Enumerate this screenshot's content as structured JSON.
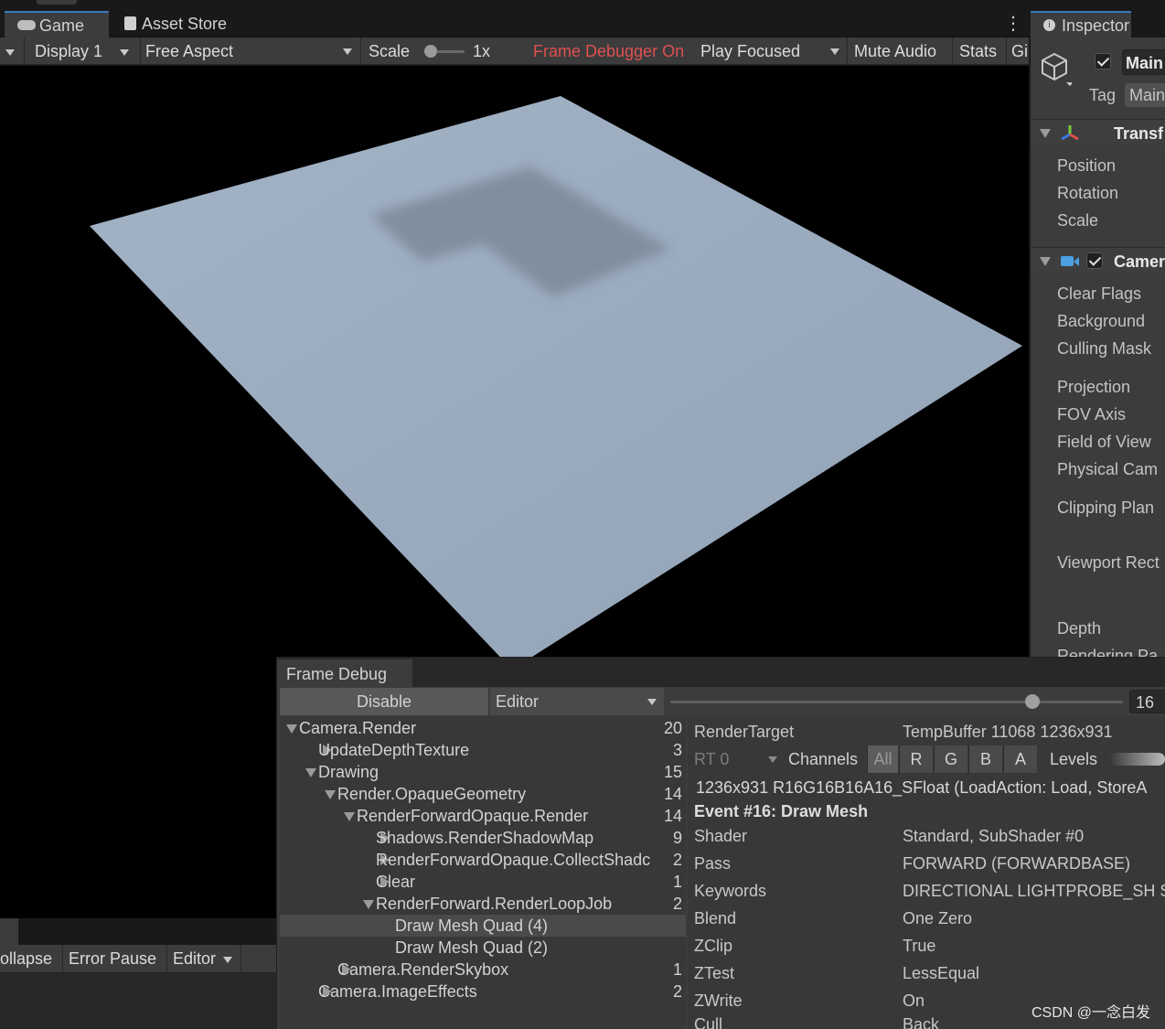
{
  "tabs": {
    "game": "Game",
    "asset_store": "Asset Store",
    "inspector": "Inspector"
  },
  "toolbar": {
    "display": "Display 1",
    "aspect": "Free Aspect",
    "scale_label": "Scale",
    "scale_value": "1x",
    "frame_debugger": "Frame Debugger On",
    "play_focused": "Play Focused",
    "mute_audio": "Mute Audio",
    "stats": "Stats",
    "gizmos": "Gi"
  },
  "colors": {
    "frame_debugger_on": "#e05050",
    "plane": "#9aabbf",
    "shadow": "#7e8b9b",
    "accent_tab": "#3a79bb"
  },
  "inspector": {
    "object_name": "Main",
    "tag_label": "Tag",
    "tag_value": "Main",
    "transform_header": "Transf",
    "transform_fields": [
      "Position",
      "Rotation",
      "Scale"
    ],
    "camera_header": "Camer",
    "camera_fields": [
      "Clear Flags",
      "Background",
      "Culling Mask",
      "Projection",
      "FOV Axis",
      "Field of View",
      "Physical Cam",
      "Clipping Plan",
      "Viewport Rect",
      "Depth",
      "Rendering Pa"
    ]
  },
  "console": {
    "collapse": "ollapse",
    "error_pause": "Error Pause",
    "editor": "Editor"
  },
  "frame_debug": {
    "tab": "Frame Debug",
    "disable": "Disable",
    "target": "Editor",
    "slider_value": 16,
    "event_field": "16",
    "tree": [
      {
        "label": "Camera.Render",
        "count": "20",
        "depth": 0,
        "state": "open"
      },
      {
        "label": "UpdateDepthTexture",
        "count": "3",
        "depth": 1,
        "state": "closed"
      },
      {
        "label": "Drawing",
        "count": "15",
        "depth": 1,
        "state": "open"
      },
      {
        "label": "Render.OpaqueGeometry",
        "count": "14",
        "depth": 2,
        "state": "open"
      },
      {
        "label": "RenderForwardOpaque.Render",
        "count": "14",
        "depth": 3,
        "state": "open"
      },
      {
        "label": "Shadows.RenderShadowMap",
        "count": "9",
        "depth": 4,
        "state": "closed"
      },
      {
        "label": "RenderForwardOpaque.CollectShadc",
        "count": "2",
        "depth": 4,
        "state": "closed"
      },
      {
        "label": "Clear",
        "count": "1",
        "depth": 4,
        "state": "closed"
      },
      {
        "label": "RenderForward.RenderLoopJob",
        "count": "2",
        "depth": 4,
        "state": "open"
      },
      {
        "label": "Draw Mesh Quad (4)",
        "count": "",
        "depth": 5,
        "state": "leaf",
        "selected": true
      },
      {
        "label": "Draw Mesh Quad (2)",
        "count": "",
        "depth": 5,
        "state": "leaf"
      },
      {
        "label": "Camera.RenderSkybox",
        "count": "1",
        "depth": 2,
        "state": "closed"
      },
      {
        "label": "Camera.ImageEffects",
        "count": "2",
        "depth": 1,
        "state": "closed"
      }
    ],
    "render_target_label": "RenderTarget",
    "render_target_value": "TempBuffer 11068 1236x931",
    "rt": "RT 0",
    "channels_label": "Channels",
    "channels": [
      "All",
      "R",
      "G",
      "B",
      "A"
    ],
    "levels": "Levels",
    "format_line": "1236x931 R16G16B16A16_SFloat (LoadAction: Load, StoreA",
    "event_title": "Event #16: Draw Mesh",
    "props": [
      {
        "k": "Shader",
        "v": "Standard, SubShader #0"
      },
      {
        "k": "Pass",
        "v": "FORWARD (FORWARDBASE)"
      },
      {
        "k": "Keywords",
        "v": "DIRECTIONAL LIGHTPROBE_SH S"
      },
      {
        "k": "Blend",
        "v": "One Zero"
      },
      {
        "k": "ZClip",
        "v": "True"
      },
      {
        "k": "ZTest",
        "v": "LessEqual"
      },
      {
        "k": "ZWrite",
        "v": "On"
      },
      {
        "k": "Cull",
        "v": "Back"
      }
    ]
  },
  "watermark": "CSDN @一念白发"
}
